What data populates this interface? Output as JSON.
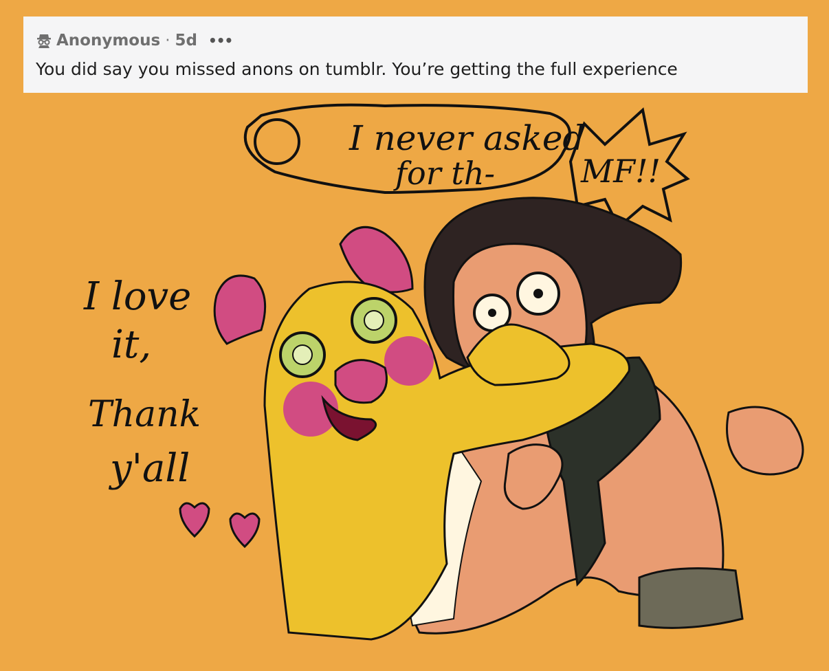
{
  "ask": {
    "icon": "anonymous-incognito-icon",
    "author": "Anonymous",
    "separator": "·",
    "age": "5d",
    "menu": "•••",
    "question": "You did say you missed anons on tumblr. You’re getting the full experience"
  },
  "artwork": {
    "speech_bubble": {
      "line1": "I never asked",
      "line2": "for th-",
      "shout": "MF!!"
    },
    "side_text": {
      "line1": "I love",
      "line2": "it,",
      "line3": "Thank",
      "line4": "y'all"
    }
  },
  "colors": {
    "background": "#EEA845",
    "card": "#F5F5F6",
    "yellow_character": "#EDC12C",
    "pink": "#D14C82",
    "skin": "#E99C72",
    "hair": "#2E2322",
    "jacket": "#2C3129"
  }
}
